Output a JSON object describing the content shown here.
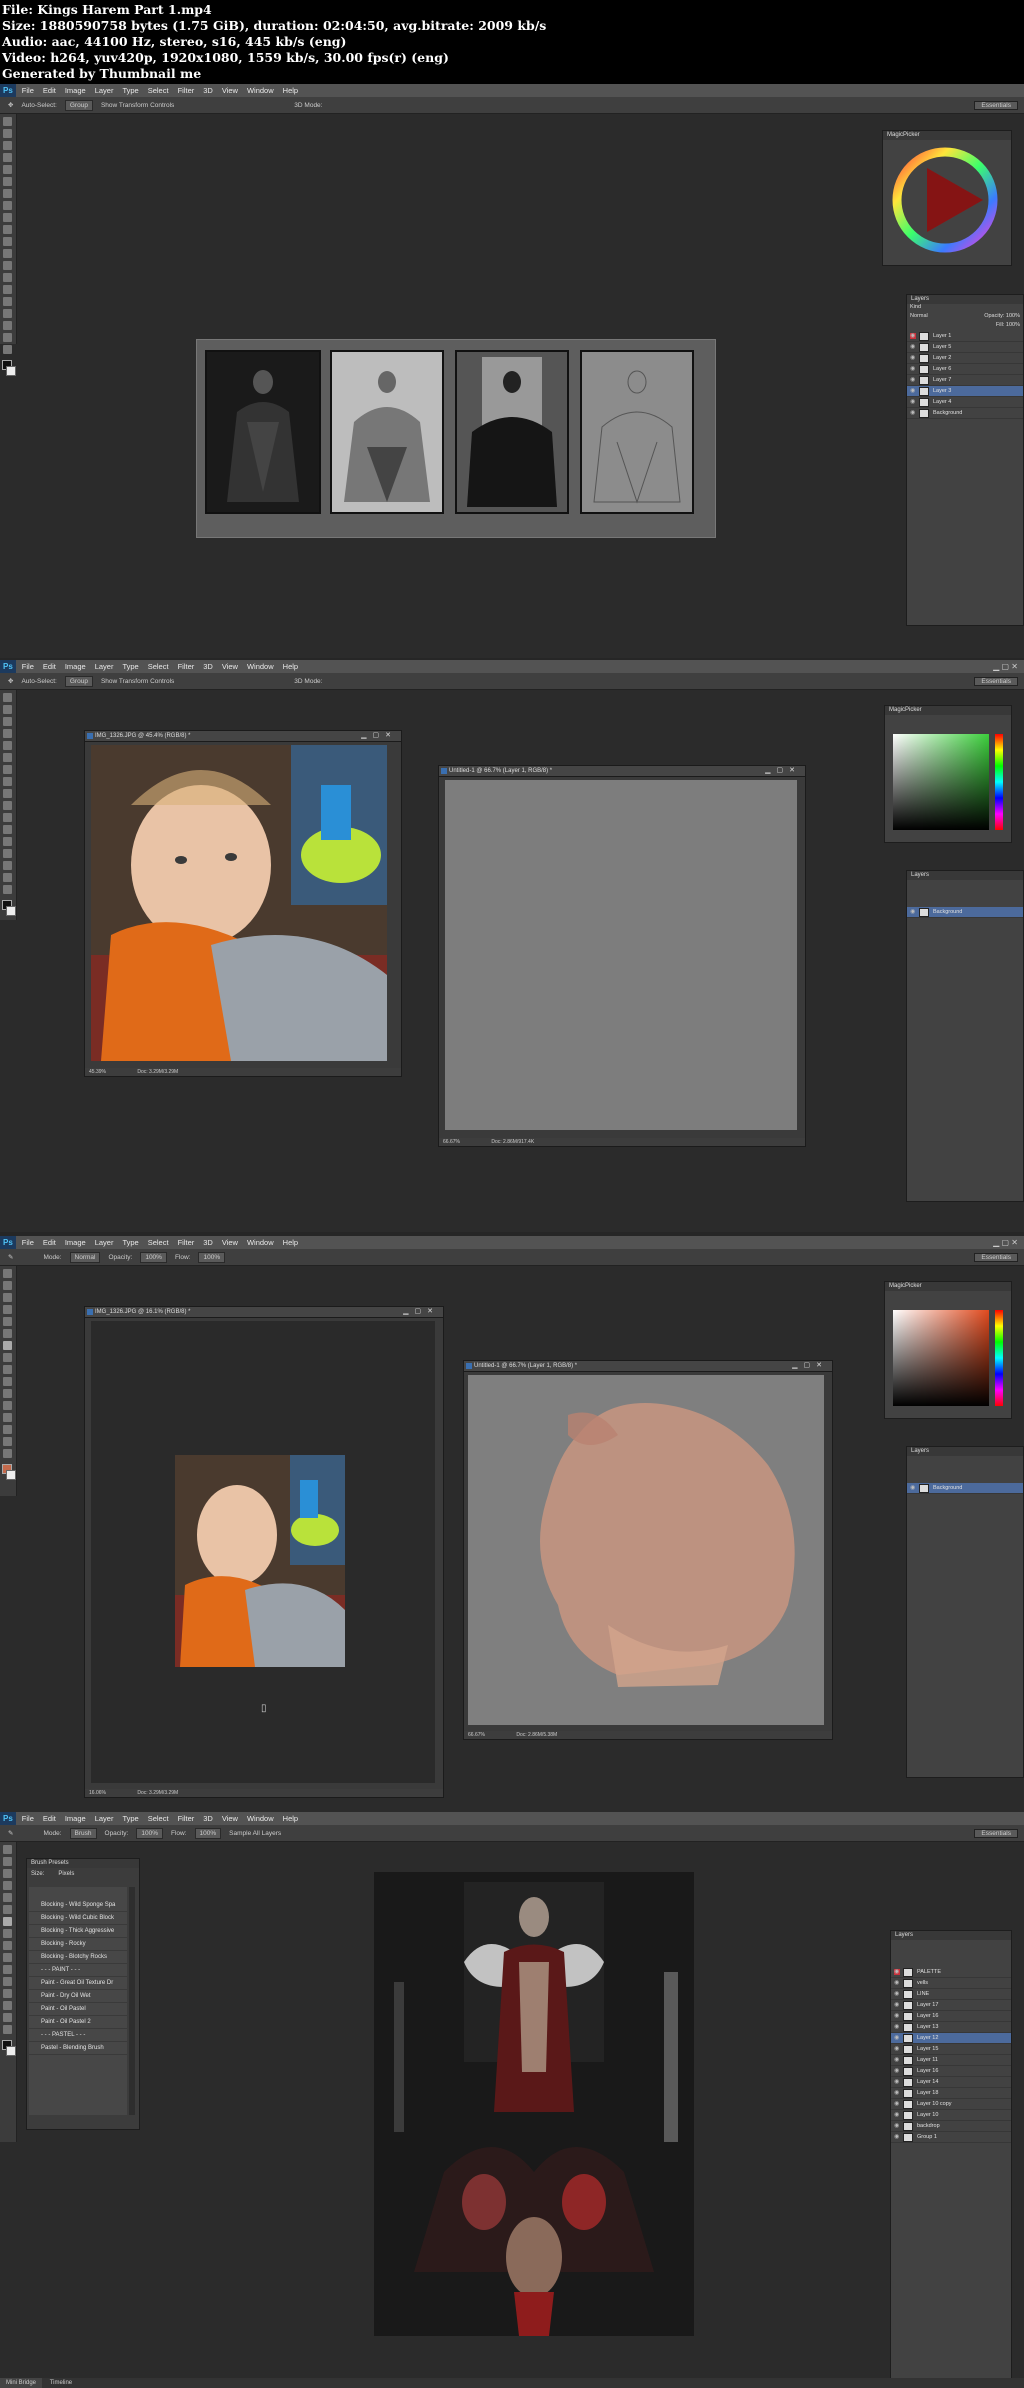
{
  "header": {
    "lines": [
      "File: Kings Harem Part 1.mp4",
      "Size: 1880590758 bytes (1.75 GiB), duration: 02:04:50, avg.bitrate: 2009 kb/s",
      "Audio: aac, 44100 Hz, stereo, s16, 445 kb/s (eng)",
      "Video: h264, yuv420p, 1920x1080, 1559 kb/s, 30.00 fps(r) (eng)",
      "Generated by Thumbnail me"
    ]
  },
  "menu": [
    "File",
    "Edit",
    "Image",
    "Layer",
    "Type",
    "Select",
    "Filter",
    "3D",
    "View",
    "Window",
    "Help"
  ],
  "ps_logo": "Ps",
  "workspace": "Essentials",
  "frame1": {
    "options": {
      "auto_select": "Auto-Select:",
      "group": "Group",
      "show_transform": "Show Transform Controls",
      "mode_3d": "3D Mode:"
    },
    "color_panel_title": "MagicPicker",
    "layers_title": "Layers",
    "blend": "Normal",
    "opacity": "Opacity: 100%",
    "fill": "Fill: 100%",
    "kind": "Kind",
    "layers": [
      "Layer 1",
      "Layer 5",
      "Layer 2",
      "Layer 6",
      "Layer 7",
      "Layer 3",
      "Layer 4",
      "Background"
    ],
    "selected_layer": 5,
    "accent_color": "#c8303a"
  },
  "frame2": {
    "options": {
      "auto_select": "Auto-Select:",
      "group": "Group",
      "show_transform": "Show Transform Controls",
      "mode_3d": "3D Mode:"
    },
    "photo_doc": {
      "title": "IMG_1326.JPG @ 45.4% (RGB/8) *",
      "zoom": "45.39%",
      "doc_size": "Doc: 3.29M/3.29M"
    },
    "canvas_doc": {
      "title": "Untitled-1 @ 66.7% (Layer 1, RGB/8) *",
      "zoom": "66.67%",
      "doc_size": "Doc: 2.86M/917.4K"
    },
    "color_panel_title": "MagicPicker",
    "layers_title": "Layers",
    "layers": [
      "Background"
    ],
    "picker_hue": "#3ccf3c"
  },
  "frame3": {
    "options": {
      "mode": "Mode:",
      "mode_value": "Normal",
      "opacity": "Opacity:",
      "opacity_value": "100%",
      "flow": "Flow:",
      "flow_value": "100%"
    },
    "photo_doc": {
      "title": "IMG_1326.JPG @ 16.1% (RGB/8) *",
      "zoom": "16.06%",
      "doc_size": "Doc: 3.29M/3.29M"
    },
    "canvas_doc": {
      "title": "Untitled-1 @ 66.7% (Layer 1, RGB/8) *",
      "zoom": "66.67%",
      "doc_size": "Doc: 2.86M/5.38M"
    },
    "color_panel_title": "MagicPicker",
    "layers_title": "Layers",
    "layers": [
      "Background"
    ],
    "picker_hue": "#e04a1e"
  },
  "frame4": {
    "options": {
      "mode": "Mode:",
      "mode_value": "Brush",
      "opacity": "Opacity:",
      "opacity_value": "100%",
      "flow": "Flow:",
      "flow_value": "100%",
      "smooth": "Sample All Layers"
    },
    "brush_panel_title": "Brush Presets",
    "brush_size_label": "Size:",
    "brush_size_value": "Pixels",
    "brushes": [
      "Blocking - Wild Sponge Spa",
      "Blocking - Wild Cubic Block",
      "Blocking - Thick Aggressive",
      "Blocking - Rocky",
      "Blocking - Blotchy Rocks",
      "- - - PAINT - - -",
      "Paint - Great Oil Texture Dr",
      "Paint - Dry Oil Wet",
      "Paint - Oil Pastel",
      "Paint - Oil Pastel 2",
      "- - - PASTEL - - -",
      "Pastel - Blending Brush"
    ],
    "layers_title": "Layers",
    "layers": [
      "PALETTE",
      "vells",
      "LINE",
      "Layer 17",
      "Layer 16",
      "Layer 13",
      "Layer 12",
      "Layer 15",
      "Layer 11",
      "Layer 16",
      "Layer 14",
      "Layer 18",
      "Layer 10 copy",
      "Layer 10",
      "backdrop",
      "Group 1"
    ],
    "selected_layer": 6,
    "bottom_tabs": [
      "Mini Bridge",
      "Timeline"
    ]
  }
}
